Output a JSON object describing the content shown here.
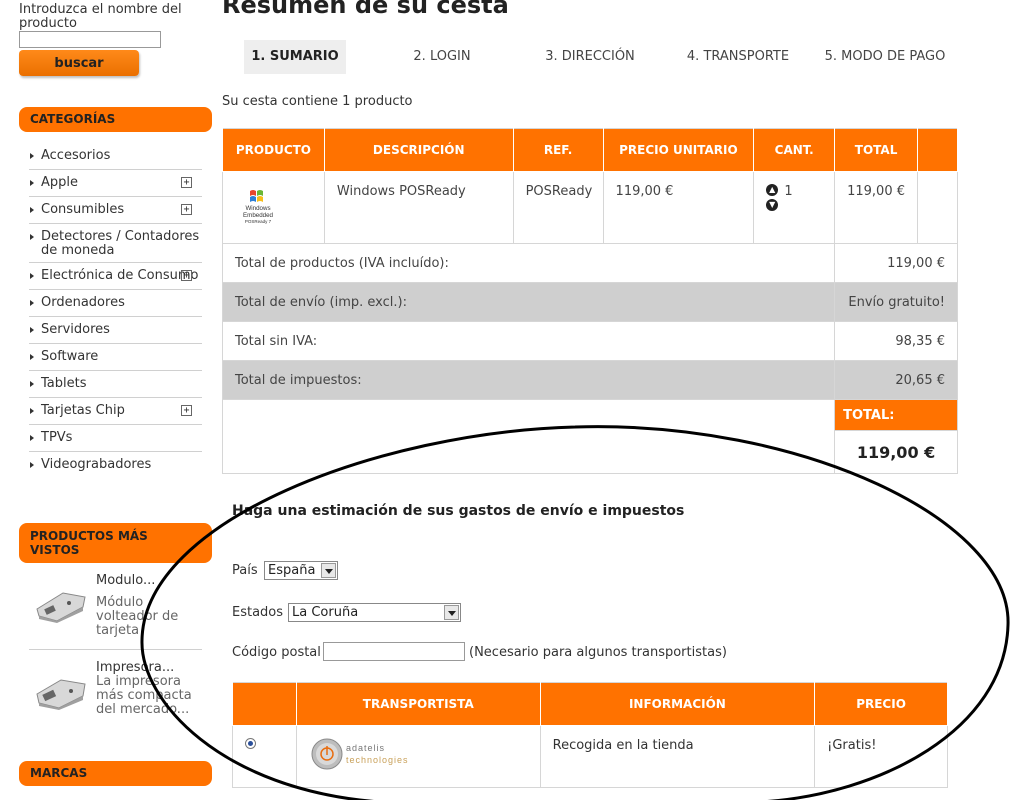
{
  "sidebar": {
    "search": {
      "label": "Introduzca el nombre del producto",
      "button": "buscar",
      "value": ""
    },
    "categories": {
      "title": "CATEGORÍAS",
      "items": [
        {
          "label": "Accesorios",
          "expandable": false
        },
        {
          "label": "Apple",
          "expandable": true
        },
        {
          "label": "Consumibles",
          "expandable": true
        },
        {
          "label": "Detectores / Contadores de moneda",
          "expandable": false
        },
        {
          "label": "Electrónica de Consumo",
          "expandable": true
        },
        {
          "label": "Ordenadores",
          "expandable": false
        },
        {
          "label": "Servidores",
          "expandable": false
        },
        {
          "label": "Software",
          "expandable": false
        },
        {
          "label": "Tablets",
          "expandable": false
        },
        {
          "label": "Tarjetas Chip",
          "expandable": true
        },
        {
          "label": "TPVs",
          "expandable": false
        },
        {
          "label": "Videograbadores",
          "expandable": false
        }
      ]
    },
    "most_viewed": {
      "title": "PRODUCTOS MÁS VISTOS",
      "items": [
        {
          "name": "Modulo...",
          "desc": "Módulo volteador de tarjeta"
        },
        {
          "name": "Impresora...",
          "desc": "La impresora más compacta del mercado..."
        }
      ]
    },
    "brands": {
      "title": "MARCAS"
    }
  },
  "main": {
    "title": "Resumen de su cesta",
    "steps": [
      "1. SUMARIO",
      "2. LOGIN",
      "3. DIRECCIÓN",
      "4. TRANSPORTE",
      "5. MODO DE PAGO"
    ],
    "active_step": 0,
    "basket_count": "Su cesta contiene 1 producto",
    "cart": {
      "headers": [
        "PRODUCTO",
        "DESCRIPCIÓN",
        "REF.",
        "PRECIO UNITARIO",
        "CANT.",
        "TOTAL"
      ],
      "row": {
        "image_text": [
          "Windows",
          "Embedded",
          "POSReady 7"
        ],
        "description": "Windows POSReady",
        "ref": "POSReady",
        "unit_price": "119,00 €",
        "qty": "1",
        "total": "119,00 €"
      },
      "summary": [
        {
          "label": "Total de productos (IVA incluído):",
          "value": "119,00 €"
        },
        {
          "label": "Total de envío (imp. excl.):",
          "value": "Envío gratuito!"
        },
        {
          "label": "Total sin IVA:",
          "value": "98,35 €"
        },
        {
          "label": "Total de impuestos:",
          "value": "20,65 €"
        }
      ],
      "total_label": "TOTAL:",
      "total_value": "119,00 €"
    },
    "estimate": {
      "title": "Haga una estimación de sus gastos de envío e impuestos",
      "country_label": "País",
      "country_value": "España",
      "state_label": "Estados",
      "state_value": "La Coruña",
      "postal_label": "Código postal",
      "postal_value": "",
      "postal_hint": "(Necesario para algunos transportistas)"
    },
    "carriers": {
      "headers": [
        "TRANSPORTISTA",
        "INFORMACIÓN",
        "PRECIO"
      ],
      "rows": [
        {
          "logo_text": [
            "adatelis",
            "technologies"
          ],
          "info": "Recogida en la tienda",
          "price": "¡Gratis!",
          "selected": true
        }
      ]
    }
  },
  "colors": {
    "accent": "#ff7200",
    "grey_row": "#cfcfcf",
    "annotation": "#000000"
  }
}
